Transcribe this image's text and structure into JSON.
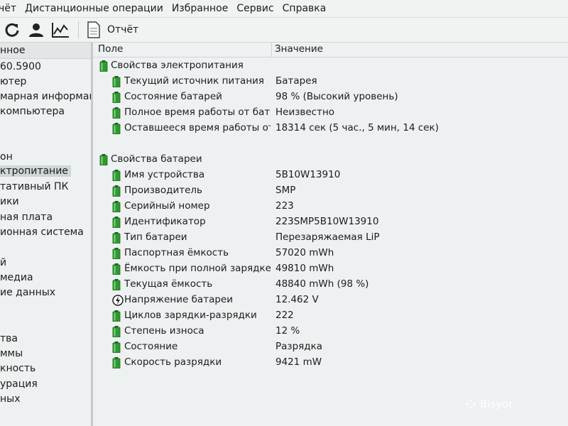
{
  "menu": [
    "чёт",
    "Дистанционные операции",
    "Избранное",
    "Сервис",
    "Справка"
  ],
  "toolbar": {
    "icons": [
      "refresh-icon",
      "user-icon",
      "chart-icon"
    ],
    "report_label": "Отчёт"
  },
  "left_pane": {
    "header": "нное",
    "items": [
      {
        "label": "60.5900",
        "selected": false
      },
      {
        "label": "ютер",
        "selected": false
      },
      {
        "label": "марная информация",
        "selected": false
      },
      {
        "label": "компьютера",
        "selected": false
      },
      {
        "label": "",
        "selected": false
      },
      {
        "label": "",
        "selected": false
      },
      {
        "label": "он",
        "selected": false
      },
      {
        "label": "ктропитание",
        "selected": true
      },
      {
        "label": "тативный ПК",
        "selected": false
      },
      {
        "label": "ики",
        "selected": false
      },
      {
        "label": "ная плата",
        "selected": false
      },
      {
        "label": "ионная система",
        "selected": false
      },
      {
        "label": "",
        "selected": false
      },
      {
        "label": "й",
        "selected": false
      },
      {
        "label": "медиа",
        "selected": false
      },
      {
        "label": "ие данных",
        "selected": false
      },
      {
        "label": "",
        "selected": false
      },
      {
        "label": "",
        "selected": false
      },
      {
        "label": "тва",
        "selected": false
      },
      {
        "label": "ммы",
        "selected": false
      },
      {
        "label": "кность",
        "selected": false
      },
      {
        "label": "урация",
        "selected": false
      },
      {
        "label": "ных",
        "selected": false
      }
    ]
  },
  "columns": {
    "field": "Поле",
    "value": "Значение"
  },
  "groups": [
    {
      "title": "Свойства электропитания",
      "rows": [
        {
          "field": "Текущий источник питания",
          "value": "Батарея",
          "icon": "battery-icon"
        },
        {
          "field": "Состояние батарей",
          "value": "98 % (Высокий уровень)",
          "icon": "battery-icon"
        },
        {
          "field": "Полное время работы от батар...",
          "value": "Неизвестно",
          "icon": "battery-icon"
        },
        {
          "field": "Оставшееся время работы от б...",
          "value": "18314 сек (5 час., 5 мин, 14 сек)",
          "icon": "battery-icon"
        }
      ]
    },
    {
      "title": "Свойства батареи",
      "rows": [
        {
          "field": "Имя устройства",
          "value": "5B10W13910",
          "icon": "battery-icon"
        },
        {
          "field": "Производитель",
          "value": "SMP",
          "icon": "battery-icon"
        },
        {
          "field": "Серийный номер",
          "value": "223",
          "icon": "battery-icon"
        },
        {
          "field": "Идентификатор",
          "value": "223SMP5B10W13910",
          "icon": "battery-icon"
        },
        {
          "field": "Тип батареи",
          "value": "Перезаряжаемая LiP",
          "icon": "battery-icon"
        },
        {
          "field": "Паспортная ёмкость",
          "value": "57020 mWh",
          "icon": "battery-icon"
        },
        {
          "field": "Ёмкость при полной зарядке",
          "value": "49810 mWh",
          "icon": "battery-icon"
        },
        {
          "field": "Текущая ёмкость",
          "value": "48840 mWh  (98 %)",
          "icon": "battery-icon"
        },
        {
          "field": "Напряжение батареи",
          "value": "12.462 V",
          "icon": "voltage-icon"
        },
        {
          "field": "Циклов зарядки-разрядки",
          "value": "222",
          "icon": "battery-icon"
        },
        {
          "field": "Степень износа",
          "value": "12 %",
          "icon": "battery-icon"
        },
        {
          "field": "Состояние",
          "value": "Разрядка",
          "icon": "battery-icon"
        },
        {
          "field": "Скорость разрядки",
          "value": "9421 mW",
          "icon": "battery-icon"
        }
      ]
    }
  ],
  "watermark": "Bisyor",
  "colors": {
    "battery_green": "#2e9a2e",
    "selected_bg": "#d0d6d8"
  }
}
